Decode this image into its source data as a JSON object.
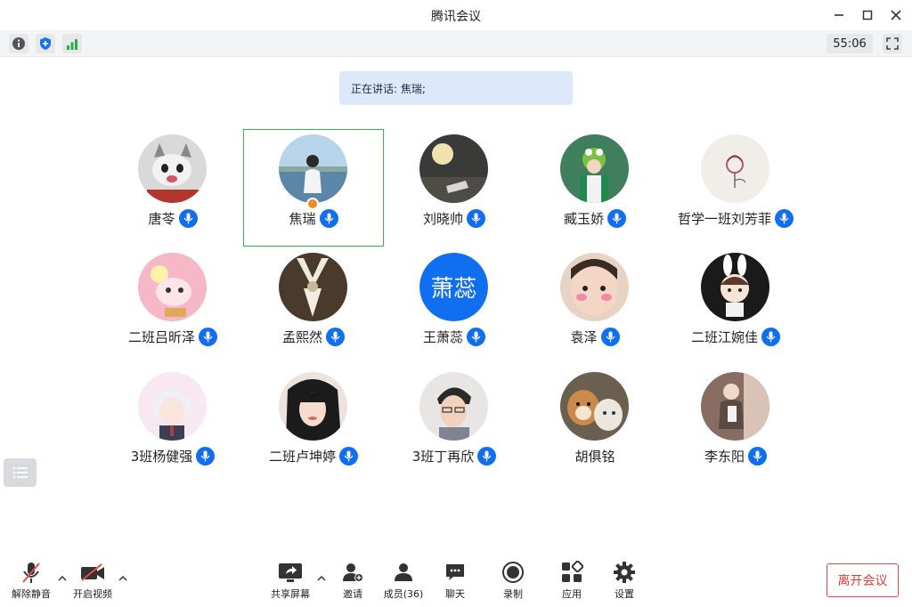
{
  "window": {
    "title": "腾讯会议"
  },
  "toolbar": {
    "timer": "55:06"
  },
  "speaking": {
    "text": "正在讲话: 焦瑞;"
  },
  "participants": [
    {
      "name": "唐苓",
      "mic": true
    },
    {
      "name": "焦瑞",
      "mic": true,
      "active": true,
      "host": true
    },
    {
      "name": "刘晓帅",
      "mic": true
    },
    {
      "name": "臧玉娇",
      "mic": true
    },
    {
      "name": "哲学一班刘芳菲",
      "mic": true
    },
    {
      "name": "二班吕昕泽",
      "mic": true
    },
    {
      "name": "孟熙然",
      "mic": true
    },
    {
      "name": "王萧蕊",
      "mic": true,
      "avatar_text": "萧蕊"
    },
    {
      "name": "袁泽",
      "mic": true
    },
    {
      "name": "二班江婉佳",
      "mic": true
    },
    {
      "name": "3班杨健强",
      "mic": true
    },
    {
      "name": "二班卢坤婷",
      "mic": true
    },
    {
      "name": "3班丁再欣",
      "mic": true
    },
    {
      "name": "胡俱铭",
      "mic": false
    },
    {
      "name": "李东阳",
      "mic": true
    }
  ],
  "bottom": {
    "unmute": "解除静音",
    "start_video": "开启视频",
    "share_screen": "共享屏幕",
    "invite": "邀请",
    "members": "成员(36)",
    "chat": "聊天",
    "record": "录制",
    "apps": "应用",
    "settings": "设置",
    "leave": "离开会议"
  },
  "colors": {
    "accent": "#0f6ff0",
    "active_border": "#2db84d",
    "leave": "#e03d3d",
    "signal": "#22b14c"
  }
}
